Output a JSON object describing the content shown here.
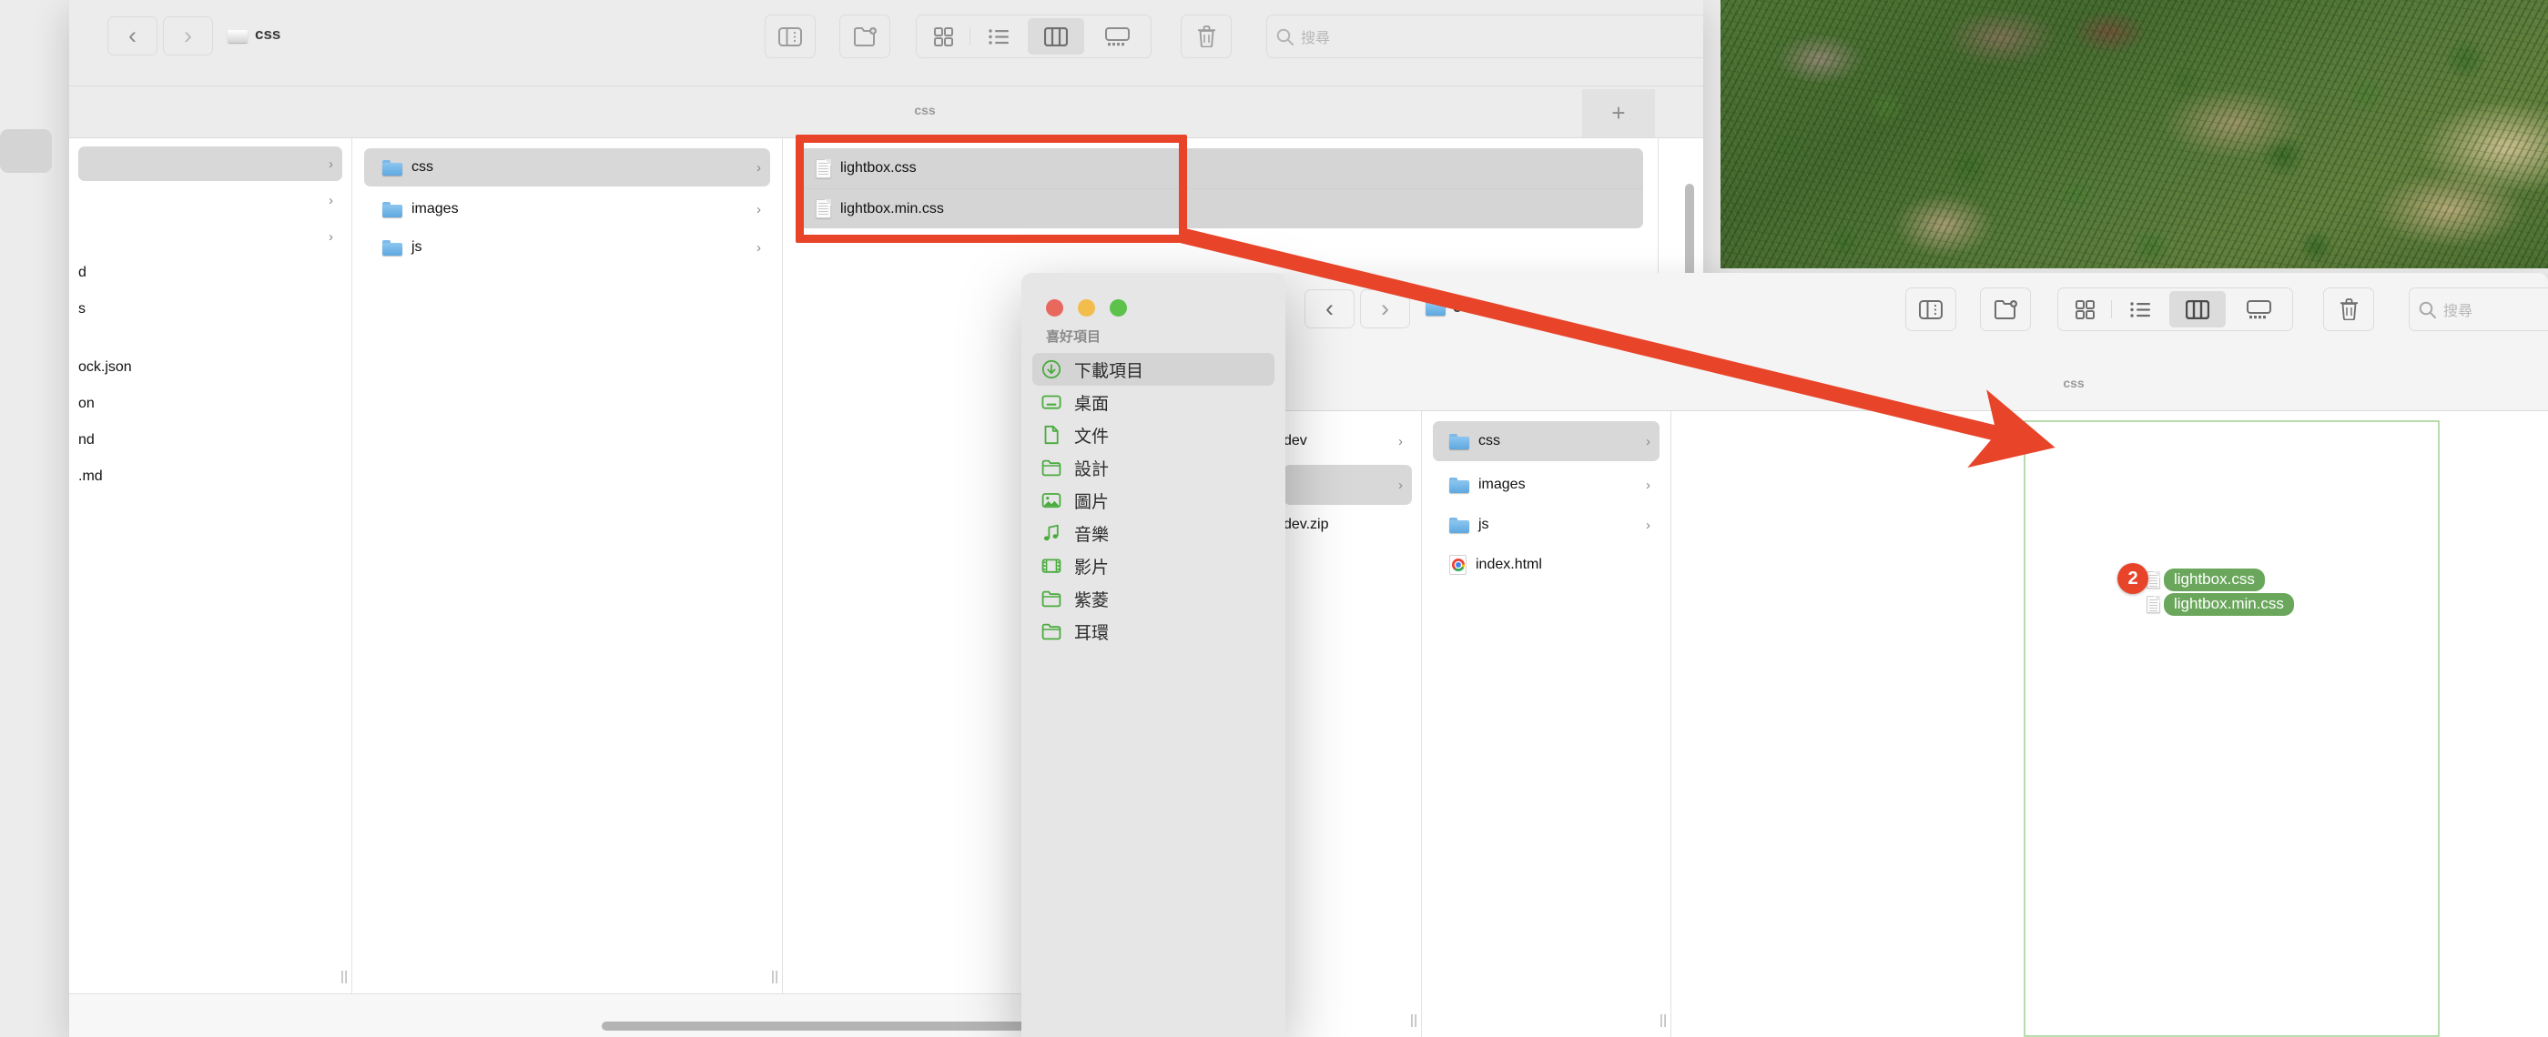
{
  "desktop": {
    "wallpaper_name": "forest-hillside-photo"
  },
  "window_back": {
    "title_path": "css",
    "toolbar": {
      "back_label": "‹",
      "forward_label": "›",
      "sidebar_toggle_name": "sidebar-toggle",
      "new_folder_name": "new-folder",
      "view_icon_label": "icon-view",
      "view_list_label": "list-view",
      "view_column_label": "column-view",
      "view_gallery_label": "gallery-view",
      "trash_label": "trash",
      "search_placeholder": "搜尋",
      "active_view": "column-view"
    },
    "tab": {
      "title": "css",
      "new_tab_label": "+"
    },
    "columns": [
      {
        "name": "clipped-column",
        "items": [
          {
            "label": "",
            "type": "folder",
            "selected": true,
            "chevron": "›"
          },
          {
            "label": "",
            "type": "folder",
            "selected": false,
            "chevron": "›"
          },
          {
            "label": "",
            "type": "folder",
            "selected": false,
            "chevron": "›"
          },
          {
            "label": "d",
            "type": "file",
            "selected": false,
            "chevron": ""
          },
          {
            "label": "s",
            "type": "file",
            "selected": false,
            "chevron": ""
          },
          {
            "label": "ock.json",
            "type": "file",
            "selected": false,
            "chevron": ""
          },
          {
            "label": "on",
            "type": "file",
            "selected": false,
            "chevron": ""
          },
          {
            "label": "nd",
            "type": "file",
            "selected": false,
            "chevron": ""
          },
          {
            "label": ".md",
            "type": "file",
            "selected": false,
            "chevron": ""
          }
        ]
      },
      {
        "name": "folder-column",
        "items": [
          {
            "label": "css",
            "type": "folder",
            "selected": true,
            "chevron": "›"
          },
          {
            "label": "images",
            "type": "folder",
            "selected": false,
            "chevron": "›"
          },
          {
            "label": "js",
            "type": "folder",
            "selected": false,
            "chevron": "›"
          }
        ]
      },
      {
        "name": "css-contents-column",
        "items": [
          {
            "label": "lightbox.css",
            "type": "file",
            "selected": true,
            "chevron": ""
          },
          {
            "label": "lightbox.min.css",
            "type": "file",
            "selected": true,
            "chevron": ""
          }
        ]
      }
    ]
  },
  "window_front": {
    "title_path": "css",
    "toolbar": {
      "back_label": "‹",
      "forward_label": "›",
      "search_placeholder": "搜尋",
      "active_view": "column-view"
    },
    "tab": {
      "title": "css"
    },
    "columns": [
      {
        "name": "parent-column",
        "items": [
          {
            "label": "dev",
            "type": "folder",
            "selected": false,
            "chevron": "›"
          },
          {
            "label": "",
            "type": "folder",
            "selected": true,
            "chevron": "›"
          },
          {
            "label": "dev.zip",
            "type": "file",
            "selected": false,
            "chevron": ""
          }
        ]
      },
      {
        "name": "project-column",
        "items": [
          {
            "label": "css",
            "type": "folder",
            "selected": true,
            "chevron": "›"
          },
          {
            "label": "images",
            "type": "folder",
            "selected": false,
            "chevron": "›"
          },
          {
            "label": "js",
            "type": "folder",
            "selected": false,
            "chevron": "›"
          },
          {
            "label": "index.html",
            "type": "chrome",
            "selected": false,
            "chevron": ""
          }
        ]
      },
      {
        "name": "drop-target-column",
        "items": []
      }
    ]
  },
  "sidebar_dialog": {
    "traffic_lights": {
      "close": "#e8685e",
      "minimize": "#f2bd4c",
      "zoom": "#5cc24a"
    },
    "section_title": "喜好項目",
    "items": [
      {
        "label": "下載項目",
        "icon": "download-icon",
        "selected": true
      },
      {
        "label": "桌面",
        "icon": "desktop-icon",
        "selected": false
      },
      {
        "label": "文件",
        "icon": "document-icon",
        "selected": false
      },
      {
        "label": "設計",
        "icon": "folder-icon",
        "selected": false
      },
      {
        "label": "圖片",
        "icon": "photo-icon",
        "selected": false
      },
      {
        "label": "音樂",
        "icon": "music-icon",
        "selected": false
      },
      {
        "label": "影片",
        "icon": "film-icon",
        "selected": false
      },
      {
        "label": "紫菱",
        "icon": "folder-icon",
        "selected": false
      },
      {
        "label": "耳環",
        "icon": "folder-icon",
        "selected": false
      }
    ]
  },
  "annotations": {
    "highlight_color": "#e8442a",
    "arrow_color": "#e8442a",
    "drop_border_color": "#b9dcae"
  },
  "drag_ghost": {
    "count": "2",
    "count_color": "#e8442a",
    "pill_color": "#6aa75c",
    "files": [
      "lightbox.css",
      "lightbox.min.css"
    ]
  }
}
